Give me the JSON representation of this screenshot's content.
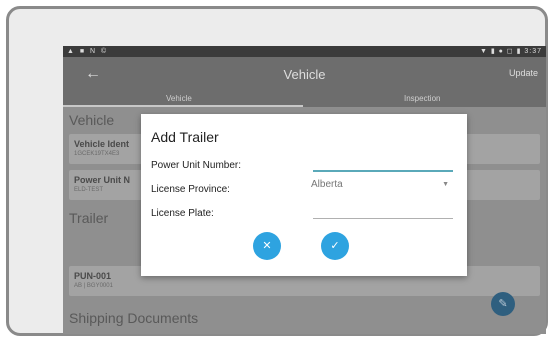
{
  "status_bar": {
    "left_icons": "▲ ■ N ©",
    "right_icons": "▼ ▮ ● ◻ ▮ 3:37"
  },
  "app_bar": {
    "back_icon": "arrow-left-icon",
    "title": "Vehicle",
    "update_label": "Update",
    "tabs": [
      {
        "label": "Vehicle"
      },
      {
        "label": "Inspection"
      }
    ]
  },
  "content": {
    "vehicle_heading": "Vehicle",
    "vehicle_id_card": {
      "title": "Vehicle Ident",
      "subtitle": "1GCEK19TX4E3"
    },
    "power_unit_card": {
      "title": "Power Unit N",
      "subtitle": "ELD-TEST"
    },
    "trailer_heading": "Trailer",
    "trailer_card": {
      "title": "PUN-001",
      "subtitle": "AB | BGY0001"
    },
    "shipping_heading": "Shipping Documents",
    "fab_icon": "edit-pencil-icon"
  },
  "dialog": {
    "title": "Add Trailer",
    "power_unit_label": "Power Unit Number:",
    "power_unit_value": "",
    "province_label": "License Province:",
    "province_value": "Alberta",
    "plate_label": "License Plate:",
    "plate_value": "",
    "cancel_icon": "close-icon",
    "ok_icon": "check-icon"
  },
  "colors": {
    "dialog_button": "#2ea3e0",
    "focused_underline": "#5aa9b9",
    "overlay": "#8f8f8f"
  }
}
